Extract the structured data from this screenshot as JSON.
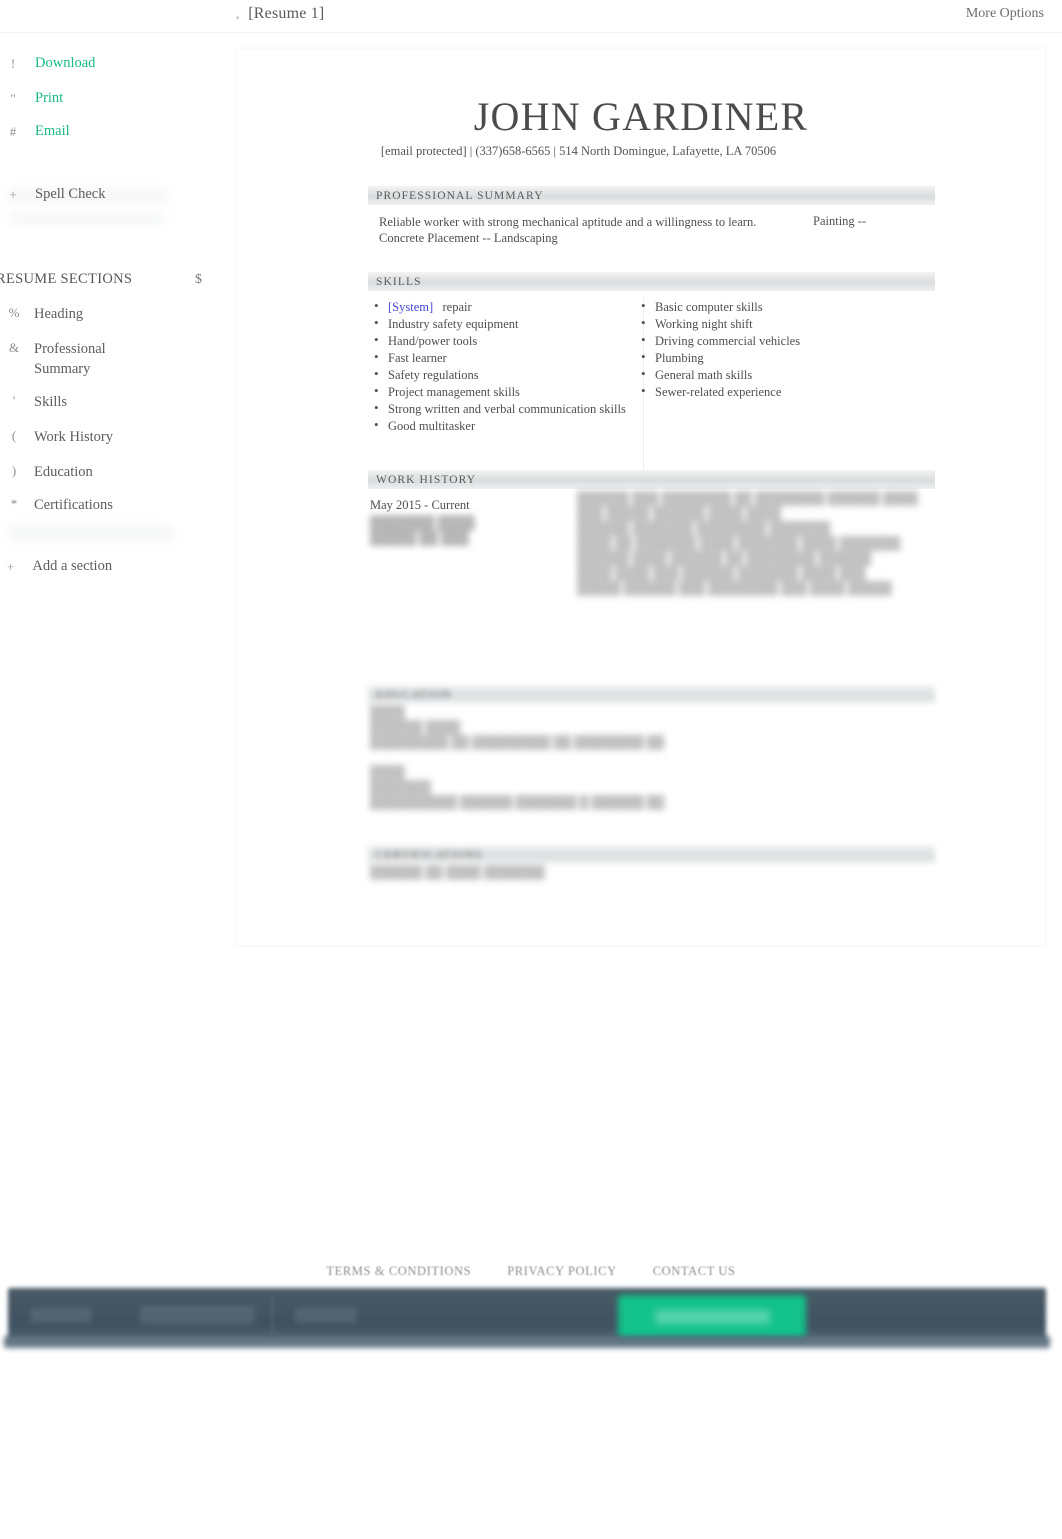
{
  "topbar": {
    "doc_icon": ",",
    "doc_title": "[Resume 1]",
    "more_options": "More Options"
  },
  "sidebar": {
    "actions": [
      {
        "icon": "!",
        "label": "Download"
      },
      {
        "icon": "\"",
        "label": "Print"
      },
      {
        "icon": "#",
        "label": "Email"
      }
    ],
    "spell_check": {
      "icon": "+",
      "label": "Spell Check"
    },
    "sections_header": {
      "title": "RESUME SECTIONS",
      "icon": "$"
    },
    "sections": [
      {
        "icon": "%",
        "label": "Heading"
      },
      {
        "icon": "&",
        "label": "Professional Summary"
      },
      {
        "icon": "'",
        "label": "Skills"
      },
      {
        "icon": "(",
        "label": "Work History"
      },
      {
        "icon": ")",
        "label": "Education"
      },
      {
        "icon": "*",
        "label": "Certifications"
      }
    ],
    "add_section": {
      "icon": "+",
      "label": "Add a section"
    }
  },
  "resume": {
    "name": "JOHN GARDINER",
    "contact": "[email protected] | (337)658-6565 | 514 North Domingue, Lafayette, LA 70506",
    "sections": {
      "summary_title": "PROFESSIONAL SUMMARY",
      "skills_title": "SKILLS",
      "work_title": "WORK HISTORY",
      "education_title": "EDUCATION",
      "certifications_title": "CERTIFICATIONS"
    },
    "summary_text": "Reliable worker with strong mechanical aptitude and a willingness to learn. Concrete Placement -- Landscaping",
    "summary_right": "Painting --",
    "skills_left": [
      {
        "prefix": "[System]",
        "text": "repair"
      },
      {
        "prefix": "",
        "text": "Industry safety equipment"
      },
      {
        "prefix": "",
        "text": "Hand/power tools"
      },
      {
        "prefix": "",
        "text": "Fast learner"
      },
      {
        "prefix": "",
        "text": "Safety regulations"
      },
      {
        "prefix": "",
        "text": "Project management skills"
      },
      {
        "prefix": "",
        "text": "Strong written and verbal communication skills"
      },
      {
        "prefix": "",
        "text": "Good multitasker"
      }
    ],
    "skills_right": [
      "Basic computer skills",
      "Working night shift",
      "Driving commercial vehicles",
      "Plumbing",
      "General math skills",
      "Sewer-related experience"
    ],
    "work_date": "May 2015 - Current"
  },
  "footer": {
    "links": [
      "TERMS & CONDITIONS",
      "PRIVACY POLICY",
      "CONTACT US"
    ]
  },
  "colors": {
    "accent_green": "#18ba87",
    "cta_green": "#12c28a",
    "bottom_bar": "#415262",
    "section_bar": "#d9dcde",
    "system_tag_blue": "#4646d8"
  }
}
